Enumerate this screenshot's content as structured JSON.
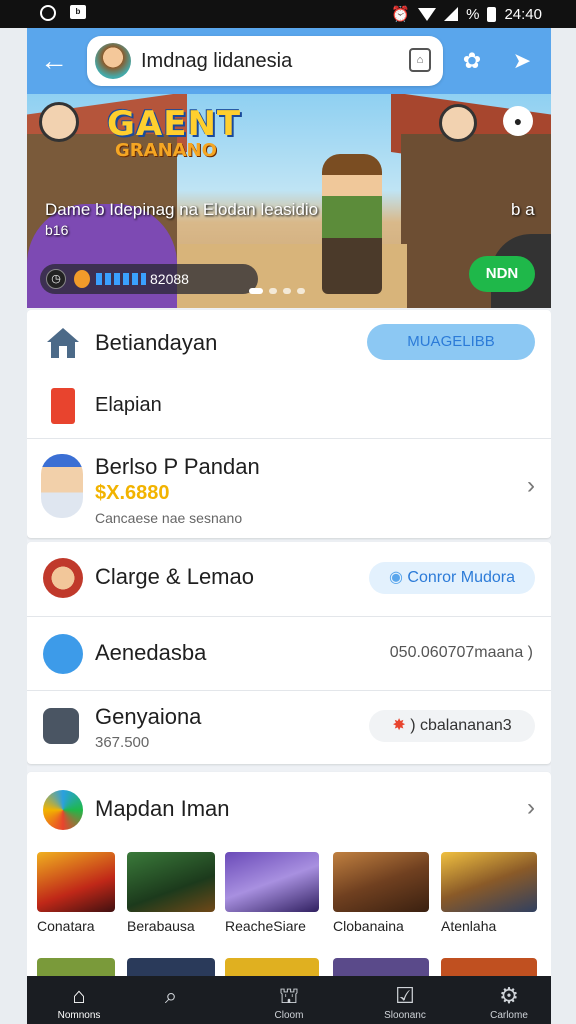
{
  "status_bar": {
    "time": "24:40",
    "battery_text": "%"
  },
  "search": {
    "text": "Imdnag lidanesia"
  },
  "banner": {
    "logo_line1": "GAENT",
    "logo_line2": "GRANANO",
    "title": "Dame b Idepinag na Elodan leasidio",
    "subtitle": "b16",
    "side_text": "b a",
    "progress_value": "82088",
    "button_label": "NDN",
    "page_count": 4,
    "active_page": 1
  },
  "card1": {
    "row1": {
      "label": "Betiandayan",
      "button": "MUAGELIBB"
    },
    "row2": {
      "label": "Elapian"
    },
    "row3": {
      "label": "Berlso P Pandan",
      "price": "$X.6880",
      "desc": "Cancaese nae sesnano"
    }
  },
  "card2": {
    "row1": {
      "label": "Clarge & Lemao",
      "chip": "Conror Mudora"
    },
    "row2": {
      "label": "Aenedasba",
      "value": "050.060707maana )"
    },
    "row3": {
      "label": "Genyaiona",
      "sub": "367.500",
      "chip": ") cbalananan3"
    }
  },
  "card3": {
    "title": "Mapdan Iman",
    "games": [
      {
        "name": "Conatara"
      },
      {
        "name": "Berabausa"
      },
      {
        "name": "ReacheSiare"
      },
      {
        "name": "Clobanaina"
      },
      {
        "name": "Atenlaha"
      }
    ]
  },
  "bottom_nav": [
    {
      "label": "Nomnons",
      "icon": "home-icon"
    },
    {
      "label": "",
      "icon": "search-icon"
    },
    {
      "label": "Cloom",
      "icon": "store-icon"
    },
    {
      "label": "Sloonanc",
      "icon": "download-icon"
    },
    {
      "label": "Carlome",
      "icon": "gear-icon"
    }
  ],
  "colors": {
    "accent": "#5aa6ec",
    "green": "#1fb84a",
    "chip_bg": "#e3f1fd",
    "price": "#f2b300"
  }
}
